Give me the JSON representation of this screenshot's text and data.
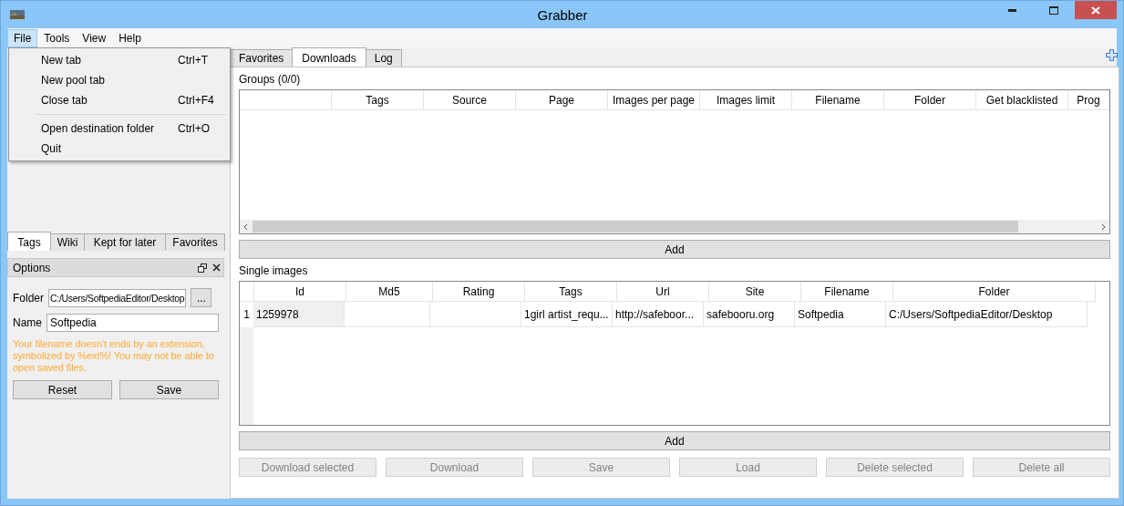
{
  "window": {
    "title": "Grabber"
  },
  "menubar": [
    {
      "label": "File",
      "selected": true
    },
    {
      "label": "Tools",
      "selected": false
    },
    {
      "label": "View",
      "selected": false
    },
    {
      "label": "Help",
      "selected": false
    }
  ],
  "file_menu": [
    {
      "kind": "item",
      "label": "New tab",
      "shortcut": "Ctrl+T"
    },
    {
      "kind": "item",
      "label": "New pool tab"
    },
    {
      "kind": "item",
      "label": "Close tab",
      "shortcut": "Ctrl+F4"
    },
    {
      "kind": "separator"
    },
    {
      "kind": "item",
      "label": "Open destination folder",
      "shortcut": "Ctrl+O"
    },
    {
      "kind": "item",
      "label": "Quit"
    }
  ],
  "left_tabs": [
    {
      "label": "Tags",
      "selected": true
    },
    {
      "label": "Wiki",
      "selected": false
    },
    {
      "label": "Kept for later",
      "selected": false
    },
    {
      "label": "Favorites",
      "selected": false
    }
  ],
  "options": {
    "title": "Options",
    "folder_label": "Folder",
    "folder_value": "C:/Users/SoftpediaEditor/Desktop",
    "browse": "...",
    "name_label": "Name",
    "name_value": "Softpedia",
    "warning": "Your filename doesn't ends by an extension, symbolized by %ext%! You may not be able to open saved files.",
    "buttons": [
      {
        "label": "Reset",
        "disabled": false
      },
      {
        "label": "Save",
        "disabled": false
      }
    ]
  },
  "main_tabs": [
    {
      "label": "Favorites",
      "selected": false
    },
    {
      "label": "Downloads",
      "selected": true
    },
    {
      "label": "Log",
      "selected": false
    }
  ],
  "groups": {
    "label": "Groups (0/0)",
    "columns": [
      "Tags",
      "Source",
      "Page",
      "Images per page",
      "Images limit",
      "Filename",
      "Folder",
      "Get blacklisted",
      "Prog"
    ],
    "add_button": "Add"
  },
  "single_images": {
    "label": "Single images",
    "columns": [
      "Id",
      "Md5",
      "Rating",
      "Tags",
      "Url",
      "Site",
      "Filename",
      "Folder"
    ],
    "rows": [
      {
        "number": "1",
        "cells": [
          "1259978",
          "",
          "",
          "1girl artist_requ...",
          "http://safeboor...",
          "safebooru.org",
          "Softpedia",
          "C:/Users/SoftpediaEditor/Desktop"
        ]
      }
    ],
    "add_button": "Add"
  },
  "bottom_buttons": [
    {
      "label": "Download selected",
      "disabled": true
    },
    {
      "label": "Download",
      "disabled": true
    },
    {
      "label": "Save",
      "disabled": true
    },
    {
      "label": "Load",
      "disabled": true
    },
    {
      "label": "Delete selected",
      "disabled": true
    },
    {
      "label": "Delete all",
      "disabled": true
    }
  ]
}
